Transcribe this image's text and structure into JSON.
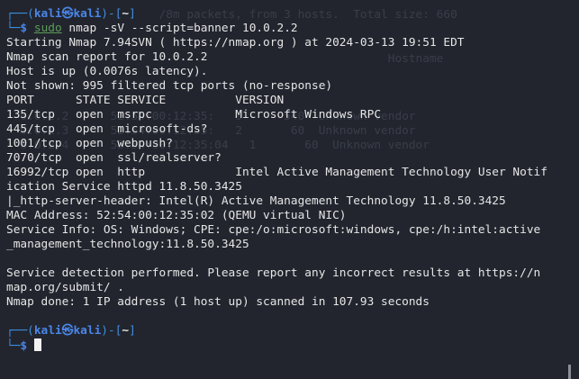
{
  "background_ghost_text": [
    "                      /8m packets, from 3 hosts.  Total size: 660",
    "",
    "",
    "                                                       Hostname",
    "",
    "",
    "  0.0.2.2      52:54:00:12:35:   9      540  Unknown vendor",
    "  0.0.2.3      52:54:00:12:35:   2       60  Unknown vendor",
    "  0.0.2.4      52:54:00:12:35:04   1       60  Unknown vendor"
  ],
  "prompt1": {
    "corner": "┌──(",
    "user": "kali",
    "at": "㉿",
    "host": "kali",
    "mid": ")-[",
    "cwd": "~",
    "end": "]",
    "corner2": "└─",
    "dollar": "$",
    "sudo": "sudo",
    "command": " nmap -sV --script=banner 10.0.2.2"
  },
  "output": [
    "Starting Nmap 7.94SVN ( https://nmap.org ) at 2024-03-13 19:51 EDT",
    "Nmap scan report for 10.0.2.2",
    "Host is up (0.0076s latency).",
    "Not shown: 995 filtered tcp ports (no-response)",
    "PORT      STATE SERVICE          VERSION",
    "135/tcp   open  msrpc            Microsoft Windows RPC",
    "445/tcp   open  microsoft-ds?",
    "1001/tcp  open  webpush?",
    "7070/tcp  open  ssl/realserver?",
    "16992/tcp open  http             Intel Active Management Technology User Notif",
    "ication Service httpd 11.8.50.3425",
    "|_http-server-header: Intel(R) Active Management Technology 11.8.50.3425",
    "MAC Address: 52:54:00:12:35:02 (QEMU virtual NIC)",
    "Service Info: OS: Windows; CPE: cpe:/o:microsoft:windows, cpe:/h:intel:active",
    "_management_technology:11.8.50.3425",
    "",
    "Service detection performed. Please report any incorrect results at https://n",
    "map.org/submit/ .",
    "Nmap done: 1 IP address (1 host up) scanned in 107.93 seconds",
    ""
  ],
  "prompt2": {
    "corner": "┌──(",
    "user": "kali",
    "at": "㉿",
    "host": "kali",
    "mid": ")-[",
    "cwd": "~",
    "end": "]",
    "corner2": "└─",
    "dollar": "$"
  }
}
